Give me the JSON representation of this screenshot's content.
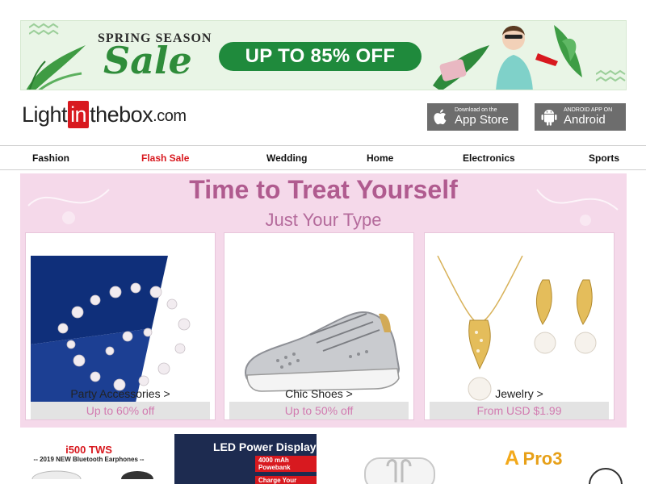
{
  "banner": {
    "season_text": "SPRING SEASON",
    "sale_text": "Sale",
    "offer_text": "UP TO 85% OFF"
  },
  "header": {
    "logo": {
      "part1": "Light",
      "part2": "in",
      "part3": "thebox",
      "part4": ".com"
    },
    "app_store": {
      "small": "Download on the",
      "big": "App Store"
    },
    "android": {
      "small": "ANDROID APP ON",
      "big": "Android"
    }
  },
  "nav": {
    "items": [
      "Fashion",
      "Flash Sale",
      "Wedding",
      "Home",
      "Electronics",
      "Sports"
    ]
  },
  "promo": {
    "title": "Time to Treat Yourself",
    "subtitle": "Just Your Type",
    "cards": [
      {
        "label": "Party Accessories >",
        "price": "Up to 60% off"
      },
      {
        "label": "Chic Shoes >",
        "price": "Up to 50% off"
      },
      {
        "label": "Jewelry >",
        "price": "From USD $1.99"
      }
    ]
  },
  "strip": {
    "i500_title": "i500 TWS",
    "i500_sub": "-- 2019 NEW Bluetooth Earphones --",
    "led_title": "LED Power Display",
    "led_chip1": "4000 mAh Powebank",
    "led_chip2": "Charge Your Phone",
    "pro3_a": "A",
    "pro3_text": "Pro3"
  },
  "colors": {
    "brand_red": "#d8191f",
    "banner_green": "#1f8a3c",
    "promo_pink": "#f5d9ea",
    "promo_text": "#b05b8f"
  }
}
